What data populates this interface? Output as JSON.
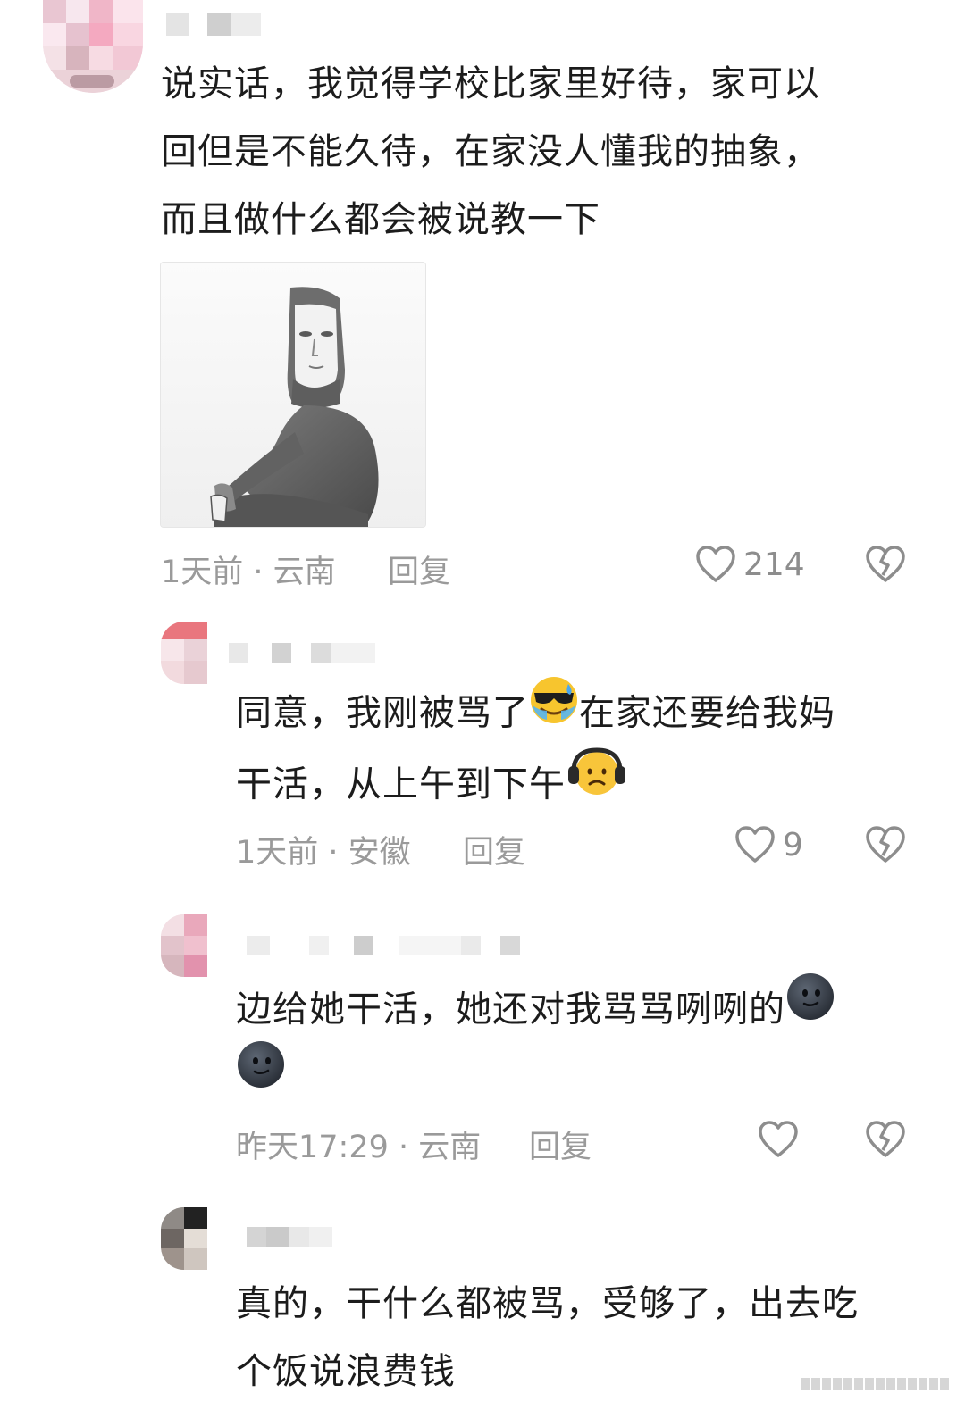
{
  "comments": [
    {
      "text_lines": [
        "说实话，我觉得学校比家里好待，家可以",
        "回但是不能久待，在家没人懂我的抽象，",
        "而且做什么都会被说教一下"
      ],
      "time_location": "1天前 · 云南",
      "reply_label": "回复",
      "like_count": "214"
    },
    {
      "text_line1_a": "同意，我刚被骂了",
      "text_line1_b": "在家还要给我妈",
      "text_line2": "干活，从上午到下午",
      "time_location": "1天前 · 安徽",
      "reply_label": "回复",
      "like_count": "9"
    },
    {
      "text_line1": "边给她干活，她还对我骂骂咧咧的",
      "time_location": "昨天17:29 · 云南",
      "reply_label": "回复",
      "like_count": ""
    },
    {
      "text_lines": [
        "真的，干什么都被骂，受够了，出去吃",
        "个饭说浪费钱"
      ]
    }
  ],
  "icons": {
    "like": "heart-outline-icon",
    "dislike": "broken-heart-icon",
    "emoji_1": "cool-face-sweat-emoji",
    "emoji_2": "headphones-frown-emoji",
    "emoji_3": "dark-smile-face-emoji"
  },
  "colors": {
    "text": "#1c1c1c",
    "meta": "#9a9a9a",
    "icon": "#8d8d8d"
  }
}
